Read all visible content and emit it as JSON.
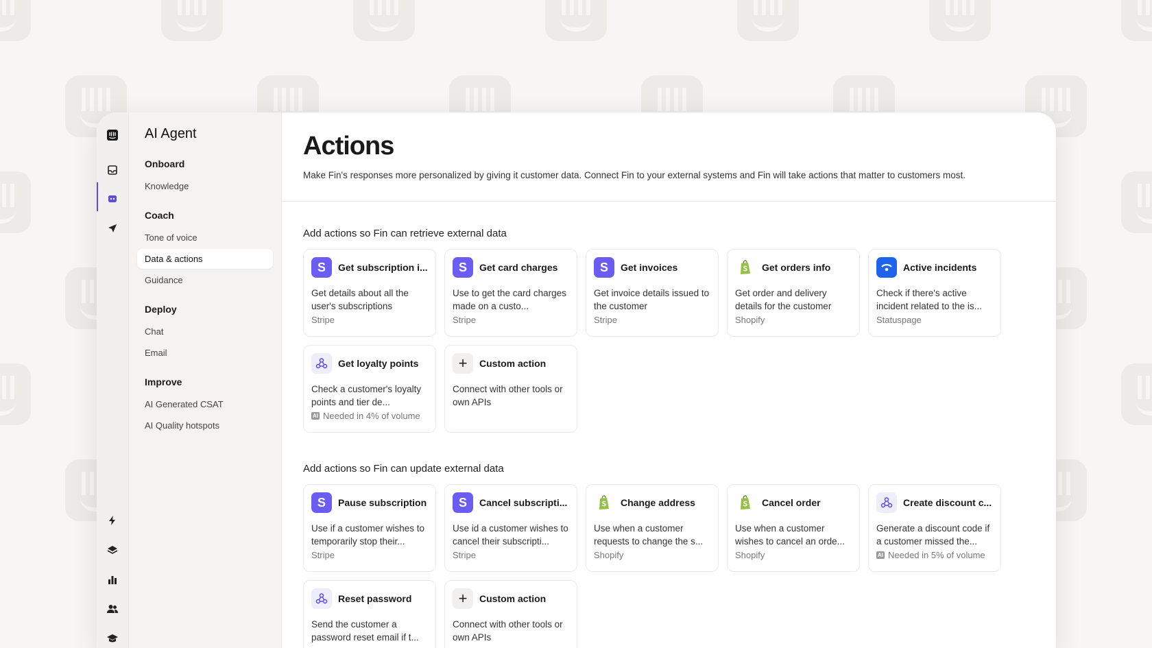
{
  "app": {
    "title": "AI Agent"
  },
  "sidebar": {
    "sections": [
      {
        "heading": "Onboard",
        "items": [
          "Knowledge"
        ]
      },
      {
        "heading": "Coach",
        "items": [
          "Tone of voice",
          "Data & actions",
          "Guidance"
        ]
      },
      {
        "heading": "Deploy",
        "items": [
          "Chat",
          "Email"
        ]
      },
      {
        "heading": "Improve",
        "items": [
          "AI Generated CSAT",
          "AI Quality hotspots"
        ]
      }
    ],
    "active_item": "Data & actions"
  },
  "main": {
    "title": "Actions",
    "description": "Make Fin's responses more personalized by giving it customer data. Connect Fin to your external systems and Fin will take actions that matter to customers most.",
    "retrieve": {
      "title": "Add actions so Fin can retrieve external data",
      "cards": [
        {
          "logo": "stripe-icon",
          "name": "Get subscription i...",
          "desc": "Get details about all the user's subscriptions",
          "source": "Stripe"
        },
        {
          "logo": "stripe-icon",
          "name": "Get card charges",
          "desc": "Use to get the card charges made on a custo...",
          "source": "Stripe"
        },
        {
          "logo": "stripe-icon",
          "name": "Get invoices",
          "desc": "Get invoice details issued to the customer",
          "source": "Stripe"
        },
        {
          "logo": "shopify-icon",
          "name": "Get orders info",
          "desc": "Get order and delivery details for the customer",
          "source": "Shopify"
        },
        {
          "logo": "statuspage-icon",
          "name": "Active incidents",
          "desc": "Check if there's active incident related to the is...",
          "source": "Statuspage"
        },
        {
          "logo": "webhook-icon",
          "name": "Get loyalty points",
          "desc": "Check a customer's loyalty points and tier de...",
          "source": "Needed in 4% of volume",
          "ai": "AI"
        },
        {
          "logo": "plus-icon",
          "name": "Custom action",
          "desc": "Connect with other tools or own APIs",
          "source": ""
        }
      ]
    },
    "update": {
      "title": "Add actions so Fin can update external data",
      "cards": [
        {
          "logo": "stripe-icon",
          "name": "Pause subscription",
          "desc": "Use if a customer wishes to temporarily stop their...",
          "source": "Stripe"
        },
        {
          "logo": "stripe-icon",
          "name": "Cancel subscripti...",
          "desc": "Use id a customer wishes to cancel their subscripti...",
          "source": "Stripe"
        },
        {
          "logo": "shopify-icon",
          "name": "Change address",
          "desc": "Use when a customer requests to change the s...",
          "source": "Shopify"
        },
        {
          "logo": "shopify-icon",
          "name": "Cancel order",
          "desc": "Use when a customer wishes to cancel an orde...",
          "source": "Shopify"
        },
        {
          "logo": "webhook-icon",
          "name": "Create discount c...",
          "desc": "Generate a discount code if a customer missed the...",
          "source": "Needed in 5% of volume",
          "ai": "AI"
        },
        {
          "logo": "webhook-icon",
          "name": "Reset password",
          "desc": "Send the customer a password reset email if t...",
          "source": ""
        },
        {
          "logo": "plus-icon",
          "name": "Custom action",
          "desc": "Connect with other tools or own APIs",
          "source": ""
        }
      ]
    }
  },
  "colors": {
    "accent": "#5b4cdb",
    "stripe": "#6b5cf2",
    "shopify": "#95bf47",
    "statuspage": "#1d63ec"
  }
}
